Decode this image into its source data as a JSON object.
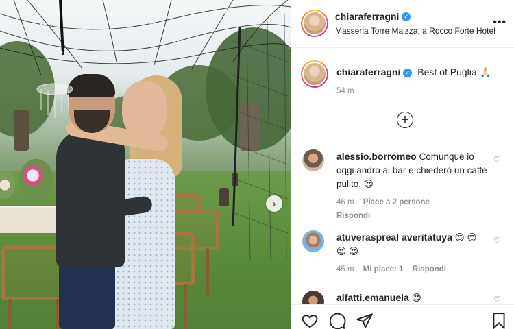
{
  "post": {
    "author": "chiaraferragni",
    "location": "Masseria Torre Maizza, a Rocco Forte Hotel",
    "more_label": "•••",
    "caption": "Best of Puglia 🙏🏻",
    "caption_time": "54 m",
    "load_more_label": "+"
  },
  "comments": [
    {
      "user": "alessio.borromeo",
      "text": "Comunque io oggi andrò al bar e chiederò un caffè pulito. 😍",
      "time": "46 m",
      "likes": "Piace a 2 persone",
      "reply": "Rispondi"
    },
    {
      "user": "atuveraspreal averitatuya",
      "text": "😍 😍 😍 😍",
      "time": "45 m",
      "likes": "Mi piace: 1",
      "reply": "Rispondi"
    },
    {
      "user": "alfatti.emanuela",
      "text": "😍"
    }
  ],
  "icons": {
    "more": "more-icon",
    "verified": "verified-badge-icon",
    "load_more": "plus-circle-icon",
    "next": "chevron-right-icon",
    "like": "heart-icon",
    "comment": "comment-icon",
    "share": "paper-plane-icon",
    "save": "bookmark-icon"
  },
  "colors": {
    "verified": "#3897f0",
    "text": "#262626",
    "muted": "#8e8e8e"
  }
}
